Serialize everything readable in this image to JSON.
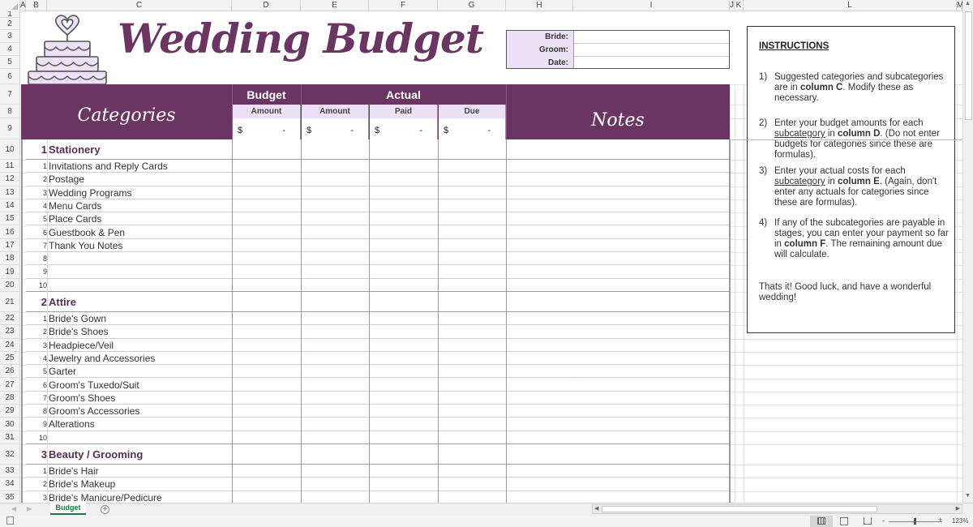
{
  "columns": [
    "A",
    "B",
    "C",
    "D",
    "E",
    "F",
    "G",
    "H",
    "I",
    "J",
    "K",
    "L",
    "M"
  ],
  "title": "Wedding Budget",
  "info_box": {
    "labels": [
      "Bride:",
      "Groom:",
      "Date:"
    ],
    "values": [
      "",
      "",
      ""
    ]
  },
  "header": {
    "categories": "Categories",
    "budget": "Budget",
    "actual": "Actual",
    "notes": "Notes",
    "sub_headers": [
      "Amount",
      "Amount",
      "Paid",
      "Due"
    ],
    "currency_symbol": "$",
    "zero_value": "-"
  },
  "categories": [
    {
      "row": "10",
      "num": "1",
      "name": "Stationery",
      "items": [
        {
          "row": "11",
          "num": "1",
          "label": "Invitations and Reply Cards"
        },
        {
          "row": "12",
          "num": "2",
          "label": "Postage"
        },
        {
          "row": "13",
          "num": "3",
          "label": "Wedding Programs"
        },
        {
          "row": "14",
          "num": "4",
          "label": "Menu Cards"
        },
        {
          "row": "15",
          "num": "5",
          "label": "Place Cards"
        },
        {
          "row": "16",
          "num": "6",
          "label": "Guestbook & Pen"
        },
        {
          "row": "17",
          "num": "7",
          "label": "Thank You Notes"
        },
        {
          "row": "18",
          "num": "8",
          "label": ""
        },
        {
          "row": "19",
          "num": "9",
          "label": ""
        },
        {
          "row": "20",
          "num": "10",
          "label": ""
        }
      ]
    },
    {
      "row": "21",
      "num": "2",
      "name": "Attire",
      "items": [
        {
          "row": "22",
          "num": "1",
          "label": "Bride's Gown"
        },
        {
          "row": "23",
          "num": "2",
          "label": "Bride's Shoes"
        },
        {
          "row": "24",
          "num": "3",
          "label": "Headpiece/Veil"
        },
        {
          "row": "25",
          "num": "4",
          "label": "Jewelry and Accessories"
        },
        {
          "row": "26",
          "num": "5",
          "label": "Garter"
        },
        {
          "row": "27",
          "num": "6",
          "label": "Groom's Tuxedo/Suit"
        },
        {
          "row": "28",
          "num": "7",
          "label": "Groom's Shoes"
        },
        {
          "row": "29",
          "num": "8",
          "label": "Groom's Accessories"
        },
        {
          "row": "30",
          "num": "9",
          "label": "Alterations"
        },
        {
          "row": "31",
          "num": "10",
          "label": ""
        }
      ]
    },
    {
      "row": "32",
      "num": "3",
      "name": "Beauty / Grooming",
      "items": [
        {
          "row": "33",
          "num": "1",
          "label": "Bride's Hair"
        },
        {
          "row": "34",
          "num": "2",
          "label": "Bride's Makeup"
        },
        {
          "row": "35",
          "num": "3",
          "label": "Bride's Manicure/Pedicure"
        }
      ]
    }
  ],
  "instructions": {
    "title": "INSTRUCTIONS",
    "steps": [
      {
        "n": "1)",
        "parts": [
          [
            "",
            "Suggested categories and subcategories are in "
          ],
          [
            "b",
            "column C"
          ],
          [
            "",
            ".  Modify these as necessary."
          ]
        ]
      },
      {
        "n": "2)",
        "parts": [
          [
            "",
            "Enter your budget amounts for each "
          ],
          [
            "u",
            "subcategory"
          ],
          [
            "",
            " in "
          ],
          [
            "b",
            "column D"
          ],
          [
            "",
            ".  (Do not enter budgets for categories since these are formulas)."
          ]
        ]
      },
      {
        "n": "3)",
        "parts": [
          [
            "",
            "Enter your actual costs for each "
          ],
          [
            "u",
            "subcategory"
          ],
          [
            "",
            " in "
          ],
          [
            "b",
            "column E"
          ],
          [
            "",
            ".  (Again, don't enter any actuals for categories since these are formulas)."
          ]
        ]
      },
      {
        "n": "4)",
        "parts": [
          [
            "",
            "If any of the subcategories are payable in stages, you can enter your payment so far in "
          ],
          [
            "b",
            "column F"
          ],
          [
            "",
            ".  The remaining amount due will calculate."
          ]
        ]
      }
    ],
    "closing": "Thats it!  Good luck, and have a wonderful wedding!"
  },
  "sheet_tabs": [
    "Budget"
  ],
  "status": {
    "zoom": "123%"
  },
  "colors": {
    "accent": "#6b3563",
    "lavender": "#ede1f7",
    "tab_green": "#217346"
  }
}
